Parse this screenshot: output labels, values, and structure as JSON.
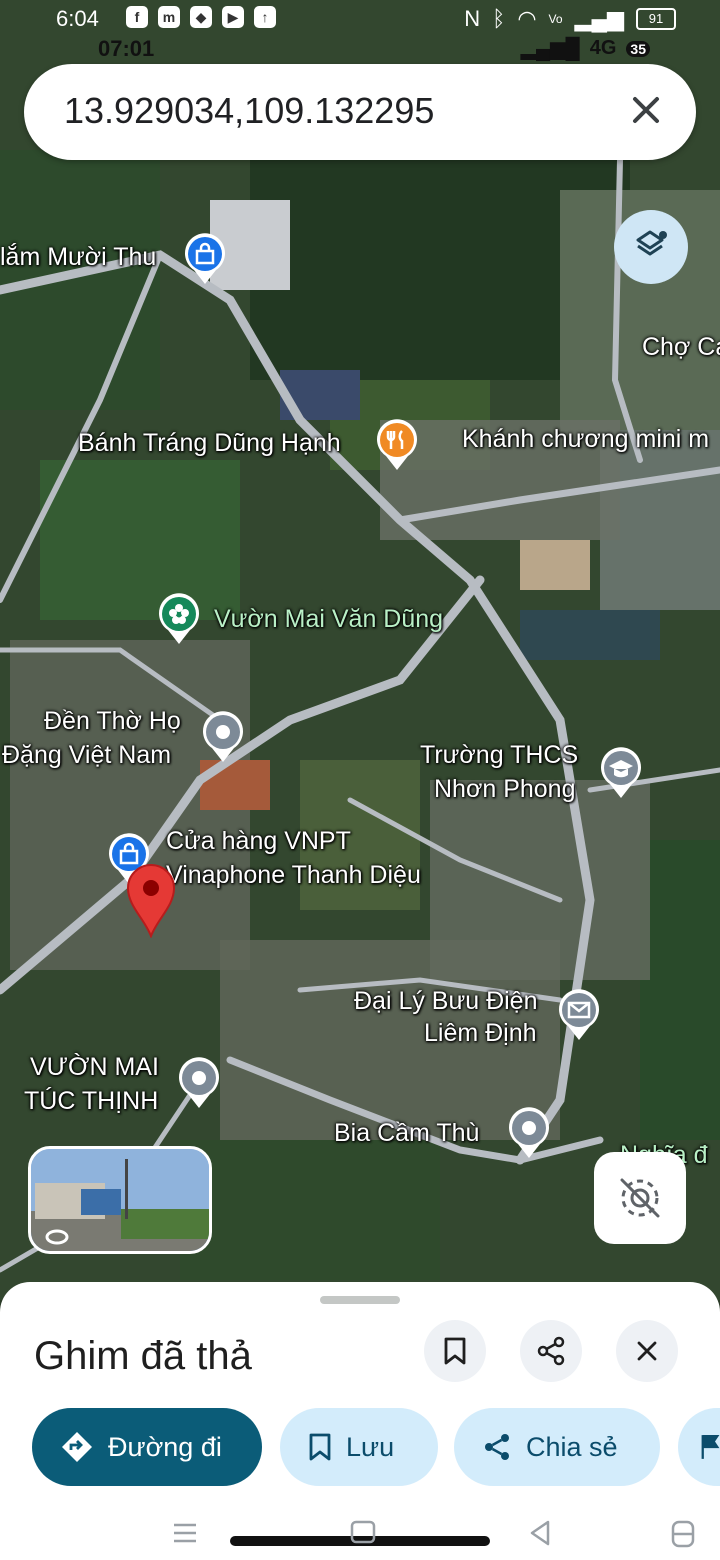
{
  "status_bar": {
    "time": "6:04",
    "time_secondary": "07:01",
    "battery": "91",
    "network": "4G",
    "network_badge": "35"
  },
  "search": {
    "query": "13.929034,109.132295"
  },
  "map_labels": [
    {
      "text": "lắm Mười Thu"
    },
    {
      "text": "Chợ Ca"
    },
    {
      "text": "Bánh Tráng Dũng Hạnh"
    },
    {
      "text": "Khánh chương mini m"
    },
    {
      "text": "Vườn Mai Văn Dũng"
    },
    {
      "text": "Đền Thờ Họ"
    },
    {
      "text": "Đặng Việt Nam"
    },
    {
      "text": "Trường THCS"
    },
    {
      "text": "Nhơn Phong"
    },
    {
      "text": "Cửa hàng VNPT"
    },
    {
      "text": "Vinaphone Thanh Diệu"
    },
    {
      "text": "Đại Lý Bưu Điện"
    },
    {
      "text": "Liêm Định"
    },
    {
      "text": "VƯỜN MAI"
    },
    {
      "text": "TÚC THỊNH"
    },
    {
      "text": "Bia Cầm Thù"
    },
    {
      "text": "Nghĩa đ"
    }
  ],
  "sheet": {
    "title": "Ghim đã thả",
    "chips": [
      {
        "label": "Đường đi"
      },
      {
        "label": "Lưu"
      },
      {
        "label": "Chia sẻ"
      }
    ]
  },
  "colors": {
    "accent": "#0b5c78",
    "chip": "#d3ecfb",
    "pin": "#e53935"
  }
}
